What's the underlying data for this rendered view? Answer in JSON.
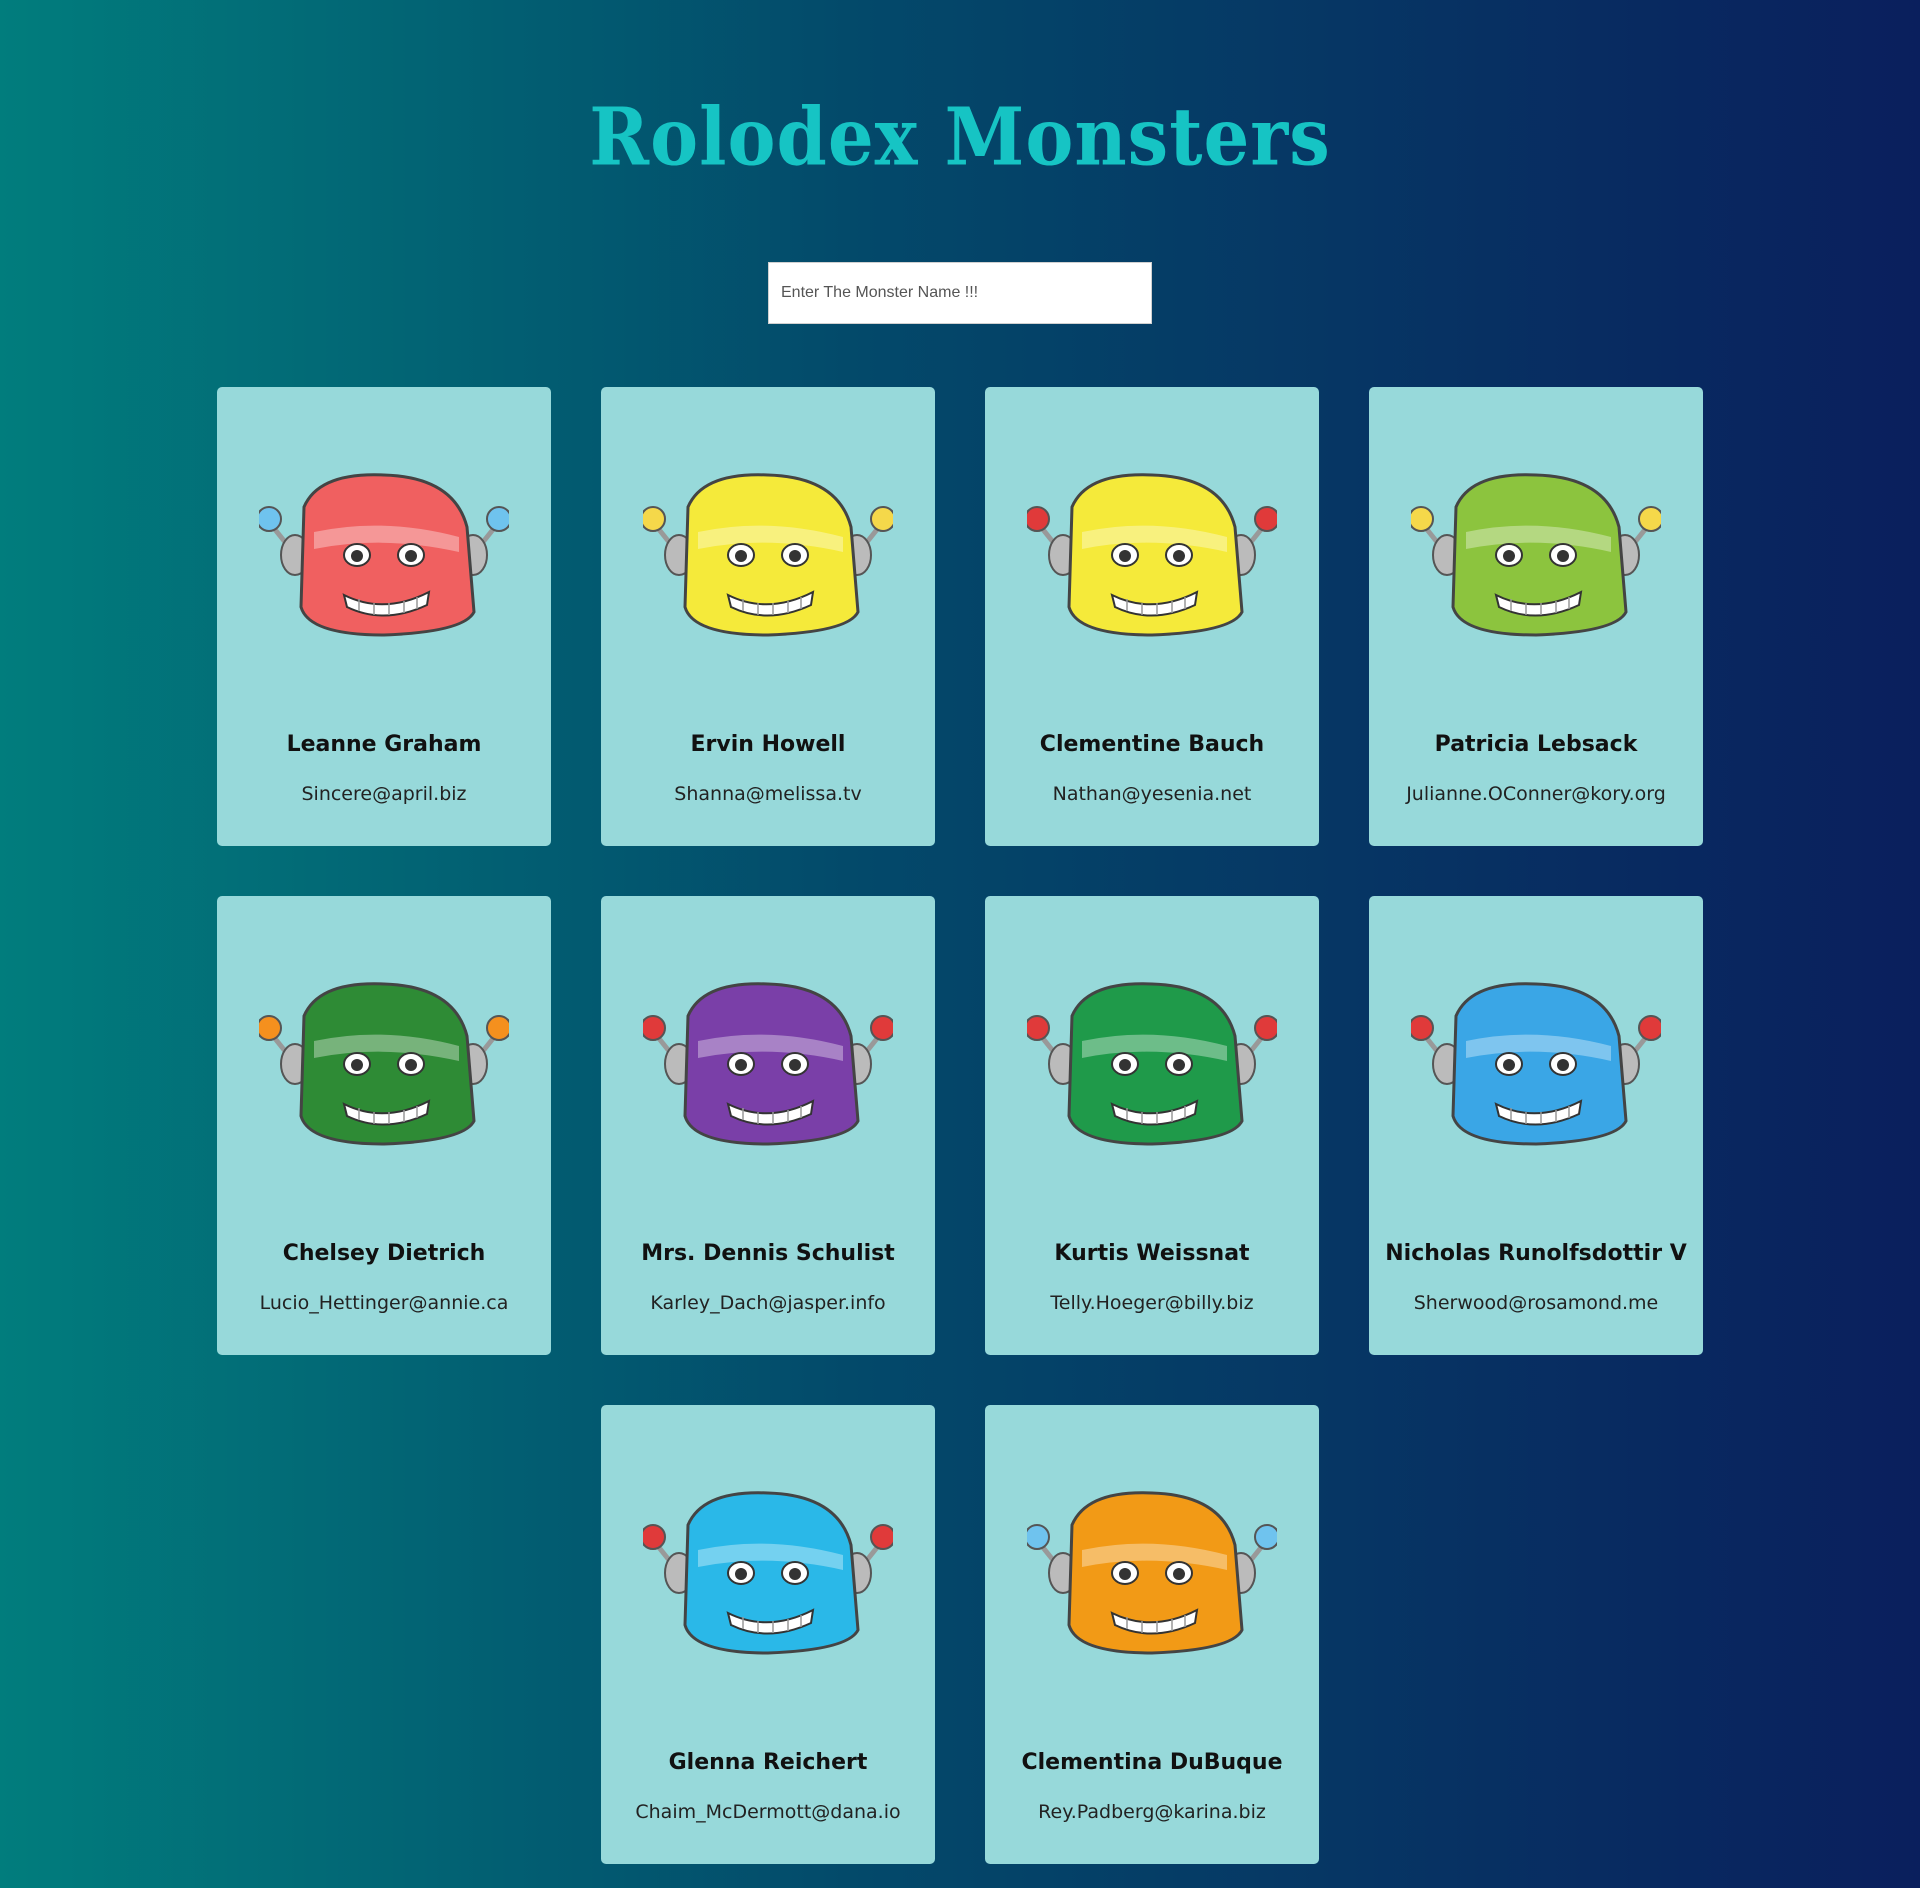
{
  "header": {
    "title": "Rolodex Monsters"
  },
  "search": {
    "placeholder": "Enter The Monster Name !!!",
    "value": ""
  },
  "monsters": [
    {
      "name": "Leanne Graham",
      "email": "Sincere@april.biz",
      "color": "#f06060",
      "accent": "#6fc3ee"
    },
    {
      "name": "Ervin Howell",
      "email": "Shanna@melissa.tv",
      "color": "#f5ea3a",
      "accent": "#f5d84a"
    },
    {
      "name": "Clementine Bauch",
      "email": "Nathan@yesenia.net",
      "color": "#f5ea3a",
      "accent": "#e03a3a"
    },
    {
      "name": "Patricia Lebsack",
      "email": "Julianne.OConner@kory.org",
      "color": "#8cc43e",
      "accent": "#f5d84a"
    },
    {
      "name": "Chelsey Dietrich",
      "email": "Lucio_Hettinger@annie.ca",
      "color": "#2e8b35",
      "accent": "#f5901e"
    },
    {
      "name": "Mrs. Dennis Schulist",
      "email": "Karley_Dach@jasper.info",
      "color": "#7a3fa8",
      "accent": "#e03a3a"
    },
    {
      "name": "Kurtis Weissnat",
      "email": "Telly.Hoeger@billy.biz",
      "color": "#1f9a4a",
      "accent": "#e03a3a"
    },
    {
      "name": "Nicholas Runolfsdottir V",
      "email": "Sherwood@rosamond.me",
      "color": "#3aa6e6",
      "accent": "#e03a3a"
    },
    {
      "name": "Glenna Reichert",
      "email": "Chaim_McDermott@dana.io",
      "color": "#2ab8e8",
      "accent": "#e03a3a"
    },
    {
      "name": "Clementina DuBuque",
      "email": "Rey.Padberg@karina.biz",
      "color": "#f29a16",
      "accent": "#6fc3ee"
    }
  ]
}
